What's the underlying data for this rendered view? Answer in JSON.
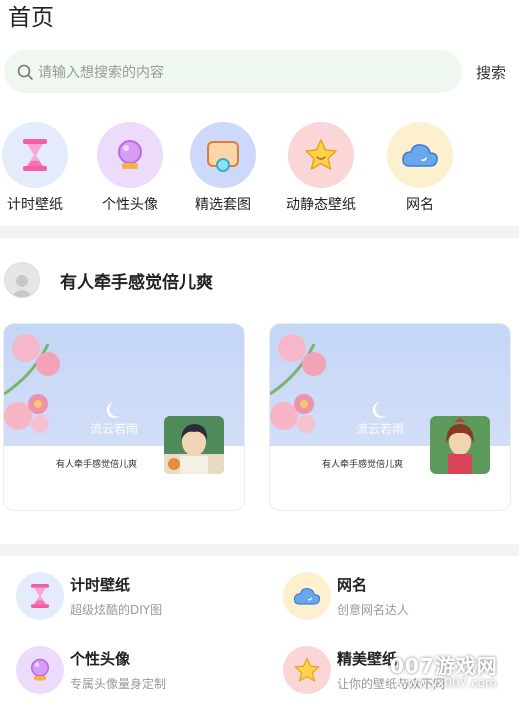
{
  "header": {
    "title": "首页"
  },
  "search": {
    "placeholder": "请输入想搜索的内容",
    "button_label": "搜索"
  },
  "categories": [
    {
      "label": "计时壁纸",
      "icon": "hourglass-icon",
      "bg": "#e4ecfb"
    },
    {
      "label": "个性头像",
      "icon": "crystal-ball-icon",
      "bg": "#ecdbfb"
    },
    {
      "label": "精选套图",
      "icon": "picture-frame-icon",
      "bg": "#cdd9fb"
    },
    {
      "label": "动静态壁纸",
      "icon": "star-icon",
      "bg": "#fbd6d6"
    },
    {
      "label": "网名",
      "icon": "cloud-icon",
      "bg": "#fdf0cf"
    }
  ],
  "feed": {
    "user_name": "有人牵手感觉倍儿爽",
    "cards": [
      {
        "watermark": "流云若雨",
        "name": "有人牵手感觉倍儿爽"
      },
      {
        "watermark": "流云若雨",
        "name": "有人牵手感觉倍儿爽"
      }
    ]
  },
  "features": [
    {
      "title": "计时壁纸",
      "subtitle": "超级炫酷的DIY图",
      "icon": "hourglass-icon"
    },
    {
      "title": "网名",
      "subtitle": "创意网名达人",
      "icon": "cloud-icon"
    },
    {
      "title": "个性头像",
      "subtitle": "专属头像量身定制",
      "icon": "crystal-ball-icon"
    },
    {
      "title": "精美壁纸",
      "subtitle": "让你的壁纸与众不同",
      "icon": "star-icon"
    }
  ],
  "overlay": {
    "watermark_main": "007游戏网",
    "watermark_sub": "www.yx007.com"
  },
  "colors": {
    "search_bg": "#eef8ee",
    "divider": "#f3f3f3",
    "card_sky": "#c4d6f6"
  }
}
